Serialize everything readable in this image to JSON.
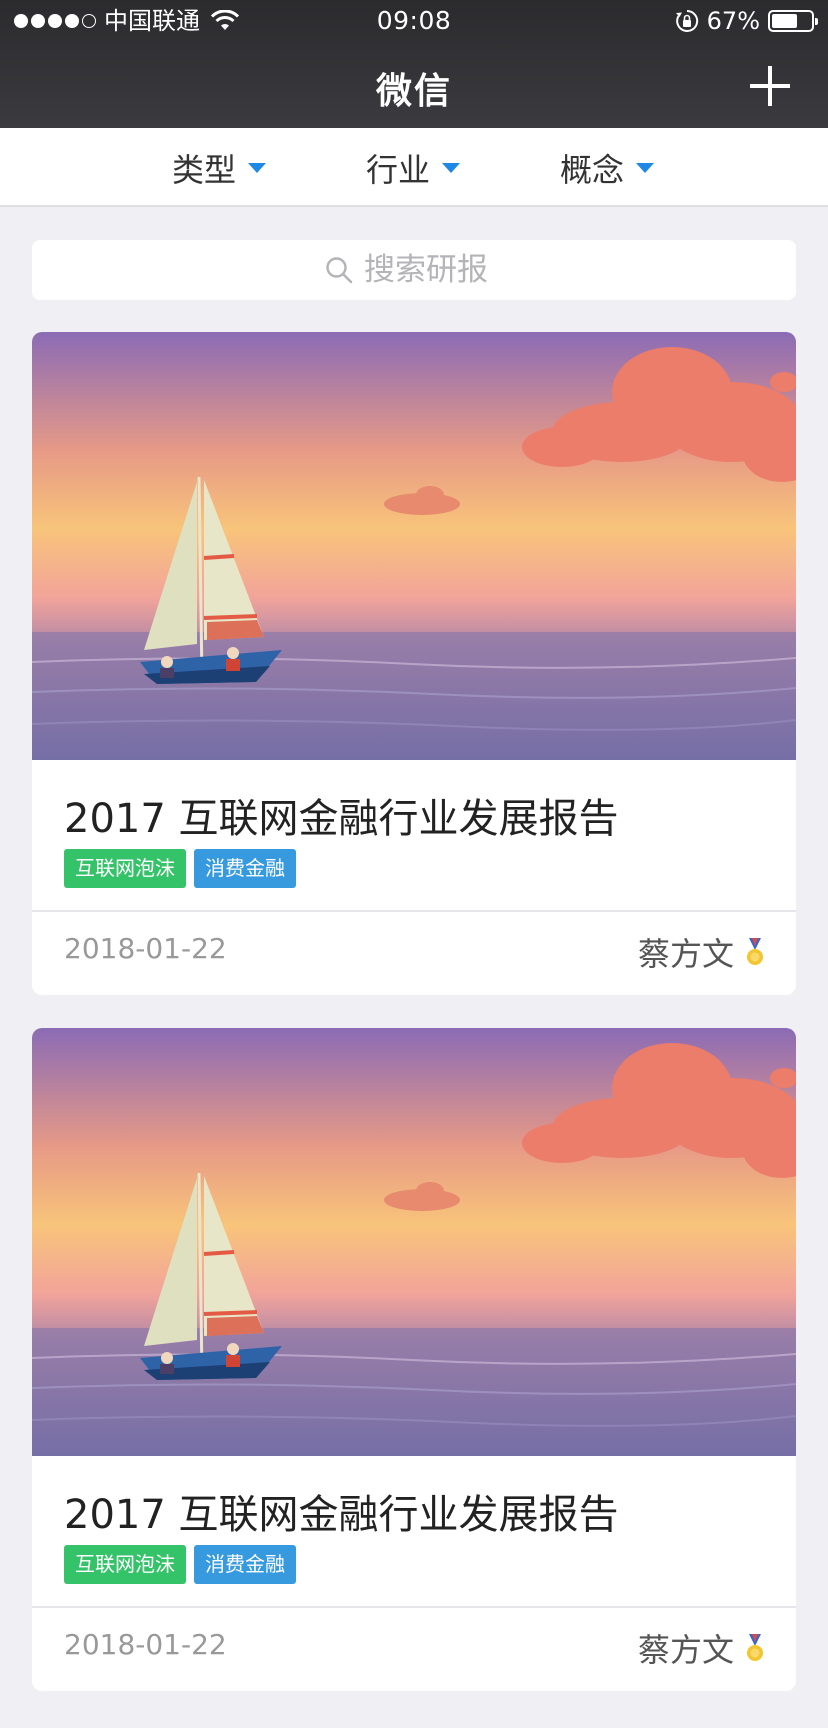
{
  "status_bar": {
    "carrier": "中国联通",
    "time": "09:08",
    "battery_percent": "67%",
    "battery_level": 0.67,
    "signal_bars_filled": 4,
    "signal_bars_total": 5
  },
  "nav": {
    "title": "微信",
    "add_icon": "plus-icon"
  },
  "filters": [
    {
      "label": "类型",
      "icon": "caret-down-icon"
    },
    {
      "label": "行业",
      "icon": "caret-down-icon"
    },
    {
      "label": "概念",
      "icon": "caret-down-icon"
    }
  ],
  "search": {
    "placeholder": "搜索研报",
    "value": "",
    "icon": "search-icon"
  },
  "reports": [
    {
      "cover": "sailboat-sunset-illustration",
      "title": "2017 互联网金融行业发展报告",
      "tags": [
        "互联网泡沫",
        "消费金融"
      ],
      "date": "2018-01-22",
      "author": "蔡方文",
      "author_badge": "medal-icon"
    },
    {
      "cover": "sailboat-sunset-illustration",
      "title": "2017 互联网金融行业发展报告",
      "tags": [
        "互联网泡沫",
        "消费金融"
      ],
      "date": "2018-01-22",
      "author": "蔡方文",
      "author_badge": "medal-icon"
    }
  ],
  "colors": {
    "header_bg": "#333336",
    "accent_blue": "#1e88e5",
    "tag_green": "#35c36a",
    "tag_blue": "#3799de",
    "page_bg": "#f0f0f4"
  }
}
